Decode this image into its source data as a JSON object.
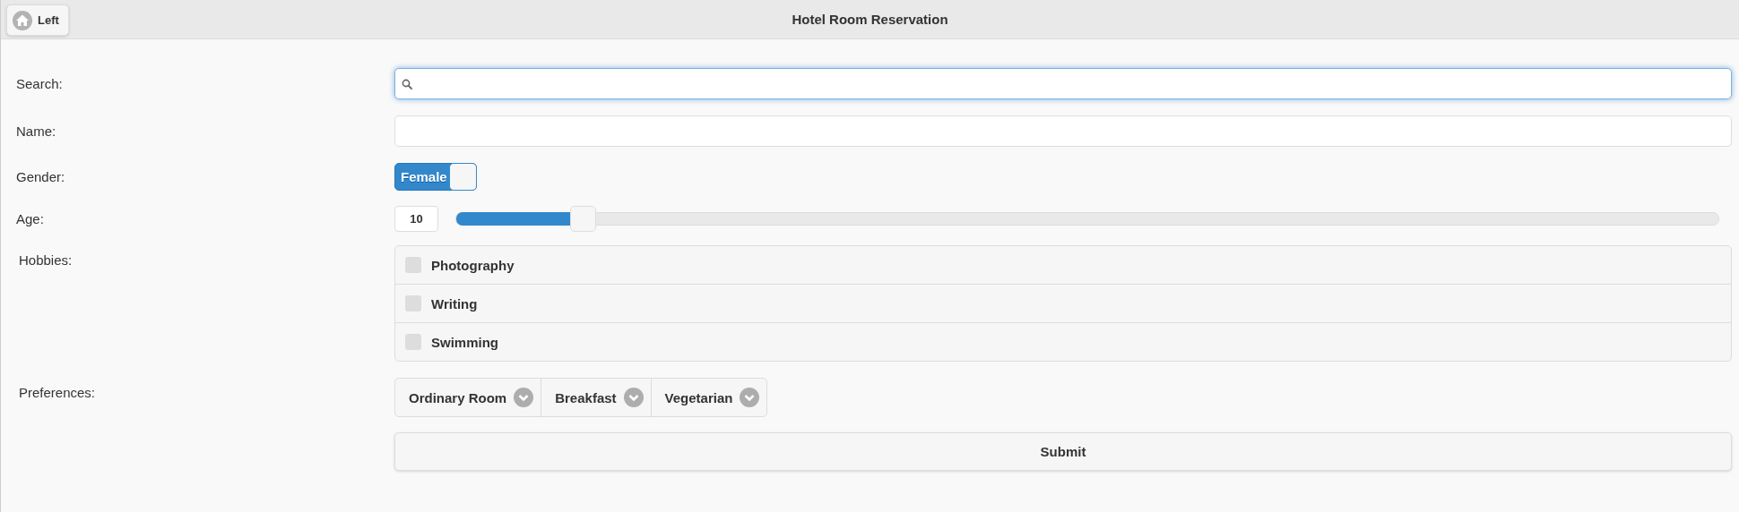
{
  "header": {
    "back_button": "Left",
    "title": "Hotel Room Reservation"
  },
  "form": {
    "search": {
      "label": "Search:"
    },
    "name": {
      "label": "Name:"
    },
    "gender": {
      "label": "Gender:",
      "switch_text": "Female",
      "on": true
    },
    "age": {
      "label": "Age:",
      "value": "10",
      "level": 0.1
    },
    "hobbies": {
      "label": "Hobbies:",
      "items": [
        {
          "label": "Photography",
          "checked": false
        },
        {
          "label": "Writing",
          "checked": false
        },
        {
          "label": "Swimming",
          "checked": false
        }
      ]
    },
    "preferences": {
      "label": "Preferences:",
      "selects": [
        "Ordinary Room",
        "Breakfast",
        "Vegetarian"
      ]
    },
    "submit": "Submit"
  }
}
